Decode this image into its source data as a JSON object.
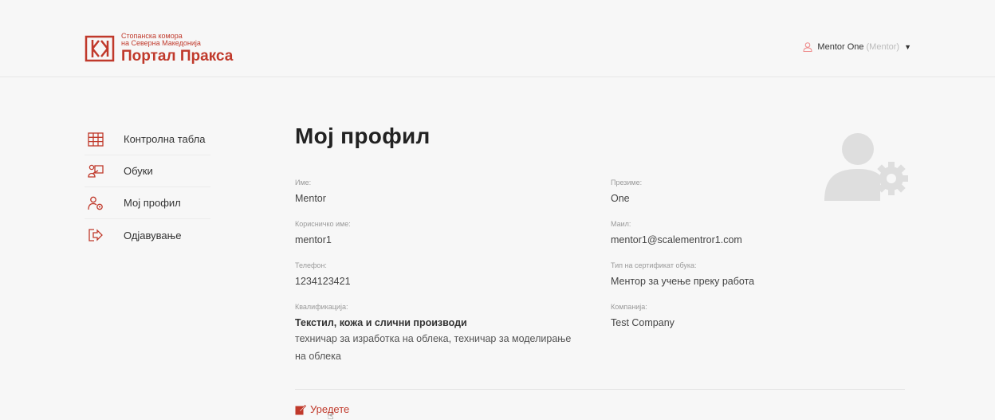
{
  "brand": {
    "line1": "Стопанска комора",
    "line2": "на Северна Македонија",
    "title": "Портал Пракса",
    "color": "#c0392b"
  },
  "user_menu": {
    "name": "Mentor One",
    "role": "(Mentor)",
    "icon": "user-icon",
    "dropdown_icon": "chevron-down-icon"
  },
  "sidebar": {
    "items": [
      {
        "label": "Контролна табла",
        "icon": "grid-icon"
      },
      {
        "label": "Обуки",
        "icon": "training-icon"
      },
      {
        "label": "Мој профил",
        "icon": "user-gear-icon"
      },
      {
        "label": "Одјавување",
        "icon": "logout-icon"
      }
    ]
  },
  "profile": {
    "title": "Мој профил",
    "avatar_icon": "user-settings-icon",
    "first_name": {
      "label": "Име:",
      "value": "Mentor"
    },
    "last_name": {
      "label": "Презиме:",
      "value": "One"
    },
    "username": {
      "label": "Корисничко име:",
      "value": "mentor1"
    },
    "email": {
      "label": "Маил:",
      "value": "mentor1@scalementror1.com"
    },
    "phone": {
      "label": "Телефон:",
      "value": "1234123421"
    },
    "cert_type": {
      "label": "Тип на сертификат обука:",
      "value": "Ментор за учење преку работа"
    },
    "qualification": {
      "label": "Квалификација:",
      "value": "Текстил, кожа и слични производи",
      "detail_line1": "техничар за изработка на облека, техничар за моделирање",
      "detail_line2": "на облека"
    },
    "company": {
      "label": "Компанија:",
      "value": "Test Company"
    },
    "edit_label": "Уредете",
    "edit_icon": "edit-icon"
  }
}
